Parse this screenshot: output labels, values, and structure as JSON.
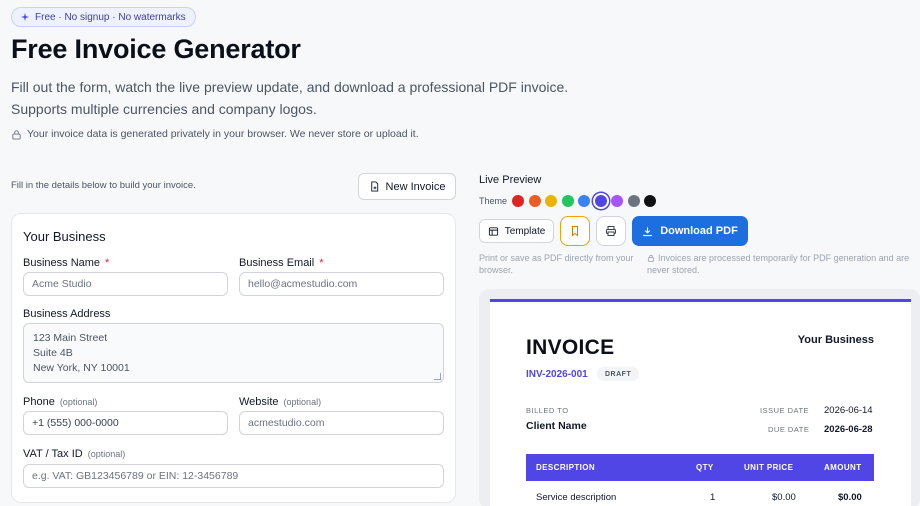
{
  "header": {
    "badge": "Free · No signup · No watermarks",
    "title": "Free Invoice Generator",
    "subtitle_line1": "Fill out the form, watch the live preview update, and download a professional PDF invoice.",
    "subtitle_line2": "Supports multiple currencies and company logos.",
    "privacy": "Your invoice data is generated privately in your browser. We never store or upload it."
  },
  "form": {
    "hint": "Fill in the details below to build your invoice.",
    "new_invoice": "New Invoice",
    "section_title": "Your Business",
    "required_marker": "*",
    "optional_marker": "(optional)",
    "business_name": {
      "label": "Business Name",
      "placeholder": "Acme Studio"
    },
    "business_email": {
      "label": "Business Email",
      "placeholder": "hello@acmestudio.com"
    },
    "business_address": {
      "label": "Business Address",
      "lines": [
        "123 Main Street",
        "Suite 4B",
        "New York, NY 10001"
      ]
    },
    "phone": {
      "label": "Phone",
      "placeholder": "+1 (555) 000-0000"
    },
    "website": {
      "label": "Website",
      "placeholder": "acmestudio.com"
    },
    "vat": {
      "label": "VAT / Tax ID",
      "placeholder": "e.g. VAT: GB123456789 or EIN: 12-3456789"
    }
  },
  "preview": {
    "label": "Live Preview",
    "theme_label": "Theme",
    "theme_colors": [
      "#e02424",
      "#f05a24",
      "#eab308",
      "#22c55e",
      "#3b82f6",
      "#4f46e5",
      "#a855f7",
      "#6b7280",
      "#111111"
    ],
    "selected_theme": "#4f46e5",
    "template_button": "Template",
    "download_button": "Download PDF",
    "note_left": "Print or save as PDF directly from your browser.",
    "note_right": "Invoices are processed temporarily for PDF generation and are never stored."
  },
  "invoice": {
    "title": "INVOICE",
    "business": "Your Business",
    "number": "INV-2026-001",
    "status": "DRAFT",
    "billed_to_label": "BILLED TO",
    "client": "Client Name",
    "issue_date_label": "ISSUE DATE",
    "issue_date": "2026-06-14",
    "due_date_label": "DUE DATE",
    "due_date": "2026-06-28",
    "columns": {
      "description": "DESCRIPTION",
      "qty": "QTY",
      "unit_price": "UNIT PRICE",
      "amount": "AMOUNT"
    },
    "rows": [
      {
        "description": "Service description",
        "qty": "1",
        "unit_price": "$0.00",
        "amount": "$0.00"
      }
    ]
  },
  "colors": {
    "accent": "#4f46e5",
    "primary_button": "#1d6fe0",
    "required": "#dc2626"
  }
}
